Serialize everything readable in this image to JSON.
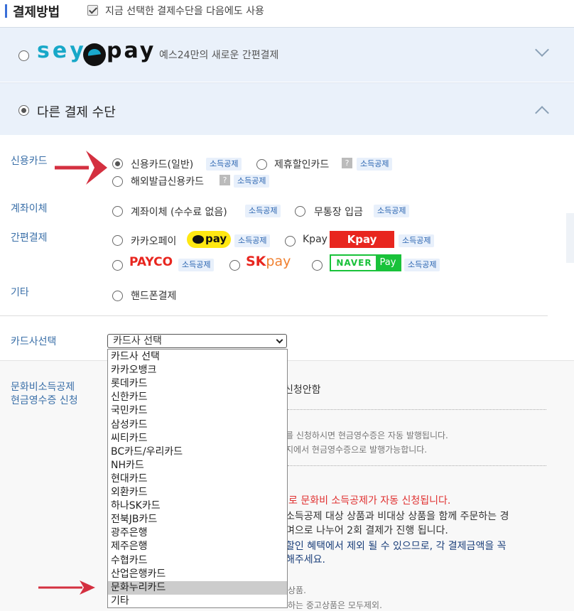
{
  "header": {
    "title": "결제방법",
    "remember_label": "지금 선택한 결제수단을 다음에도 사용"
  },
  "seypay": {
    "logo_text_1": "sey",
    "logo_text_2": "pay",
    "description": "예스24만의 새로운 간편결제"
  },
  "other": {
    "title": "다른 결제 수단"
  },
  "sections": {
    "credit": "신용카드",
    "transfer": "계좌이체",
    "simple": "간편결제",
    "etc": "기타",
    "card_company": "카드사선택",
    "culture_1": "문화비소득공제",
    "culture_2": "현금영수증 신청"
  },
  "options": {
    "credit_general": "신용카드(일반)",
    "credit_partner": "제휴할인카드",
    "credit_overseas": "해외발급신용카드",
    "transfer_account": "계좌이체 (수수료 없음)",
    "transfer_bankbook": "무통장 입금",
    "kakaopay": "카카오페이",
    "kpay": "Kpay",
    "phone": "핸드폰결제"
  },
  "badge": "소득공제",
  "question_mark": "?",
  "logos": {
    "kakao_pay": "pay",
    "kpay": "Kpay",
    "payco": "PAYCO",
    "sk": "SK",
    "sk_pay": "pay",
    "naver": "NAVER",
    "naver_pay": "Pay"
  },
  "select": {
    "selected": "카드사 선택",
    "options": [
      "카드사 선택",
      "카카오뱅크",
      "롯데카드",
      "신한카드",
      "국민카드",
      "삼성카드",
      "씨티카드",
      "BC카드/우리카드",
      "NH카드",
      "현대카드",
      "외환카드",
      "하나SK카드",
      "전북JB카드",
      "광주은행",
      "제주은행",
      "수협카드",
      "산업은행카드",
      "문화누리카드",
      "기타"
    ],
    "highlighted_index": 17
  },
  "culture": {
    "no_apply": "신청안함",
    "note1": "를 신청하시면 현금영수증은 자동 발행됩니다.",
    "note2": "지에서 현금영수증으로 발행가능합니다.",
    "red_note": "로 문화비 소득공제가 자동 신청됩니다.",
    "dark1": "소득공제 대상 상품과 비대상 상품을 함께 주문하는 경",
    "dark2": "며으로 나누어 2회 결제가 진행 됩니다.",
    "navy1": "할인 혜택에서 제외 될 수 있으므로, 각 결제금액을 꼭",
    "navy2": "해주세요.",
    "small1": "상품.",
    "small2": "하는 중고상품은 모두제외."
  },
  "colors": {
    "accent_blue": "#3a6fd8",
    "panel_bg": "#eaf1fa",
    "badge_text": "#2a64b0",
    "arrow_red": "#d43040",
    "kakao_yellow": "#ffe812",
    "naver_green": "#19c23a"
  }
}
